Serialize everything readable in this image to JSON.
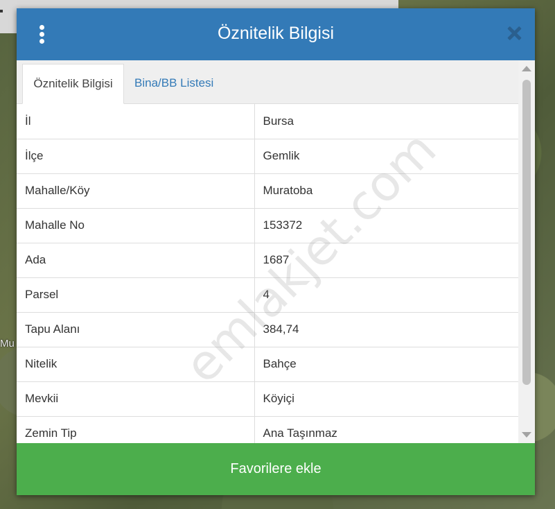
{
  "map": {
    "partial_label": "Mu"
  },
  "modal": {
    "title": "Öznitelik Bilgisi",
    "tabs": [
      {
        "label": "Öznitelik Bilgisi",
        "active": true
      },
      {
        "label": "Bina/BB Listesi",
        "active": false
      }
    ],
    "rows": [
      {
        "key": "İl",
        "value": "Bursa"
      },
      {
        "key": "İlçe",
        "value": "Gemlik"
      },
      {
        "key": "Mahalle/Köy",
        "value": "Muratoba"
      },
      {
        "key": "Mahalle No",
        "value": "153372"
      },
      {
        "key": "Ada",
        "value": "1687"
      },
      {
        "key": "Parsel",
        "value": "4"
      },
      {
        "key": "Tapu Alanı",
        "value": "384,74"
      },
      {
        "key": "Nitelik",
        "value": "Bahçe"
      },
      {
        "key": "Mevkii",
        "value": "Köyiçi"
      },
      {
        "key": "Zemin Tip",
        "value": "Ana Taşınmaz"
      }
    ],
    "favorite_button": "Favorilere ekle",
    "icons": {
      "menu": "kebab-menu-icon",
      "close": "close-icon"
    },
    "colors": {
      "header": "#337ab7",
      "button": "#4cae4c",
      "link": "#337ab7"
    }
  },
  "watermark": "emlakjet.com"
}
